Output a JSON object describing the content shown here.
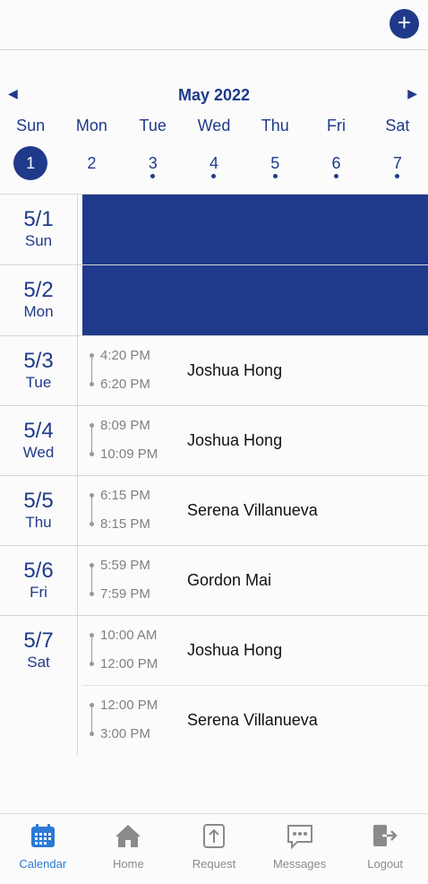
{
  "header": {
    "add_icon": "plus-icon"
  },
  "calendar": {
    "month": "May 2022",
    "weekdays": [
      "Sun",
      "Mon",
      "Tue",
      "Wed",
      "Thu",
      "Fri",
      "Sat"
    ],
    "dates": [
      {
        "num": "1",
        "selected": true,
        "dot": false
      },
      {
        "num": "2",
        "selected": false,
        "dot": false
      },
      {
        "num": "3",
        "selected": false,
        "dot": true
      },
      {
        "num": "4",
        "selected": false,
        "dot": true
      },
      {
        "num": "5",
        "selected": false,
        "dot": true
      },
      {
        "num": "6",
        "selected": false,
        "dot": true
      },
      {
        "num": "7",
        "selected": false,
        "dot": true
      }
    ]
  },
  "days": [
    {
      "date": "5/1",
      "weekday": "Sun",
      "shifts": []
    },
    {
      "date": "5/2",
      "weekday": "Mon",
      "shifts": []
    },
    {
      "date": "5/3",
      "weekday": "Tue",
      "shifts": [
        {
          "start": "4:20 PM",
          "end": "6:20 PM",
          "name": "Joshua Hong"
        }
      ]
    },
    {
      "date": "5/4",
      "weekday": "Wed",
      "shifts": [
        {
          "start": "8:09 PM",
          "end": "10:09 PM",
          "name": "Joshua Hong"
        }
      ]
    },
    {
      "date": "5/5",
      "weekday": "Thu",
      "shifts": [
        {
          "start": "6:15 PM",
          "end": "8:15 PM",
          "name": "Serena Villanueva"
        }
      ]
    },
    {
      "date": "5/6",
      "weekday": "Fri",
      "shifts": [
        {
          "start": "5:59 PM",
          "end": "7:59 PM",
          "name": "Gordon Mai"
        }
      ]
    },
    {
      "date": "5/7",
      "weekday": "Sat",
      "shifts": [
        {
          "start": "10:00 AM",
          "end": "12:00 PM",
          "name": "Joshua Hong"
        },
        {
          "start": "12:00 PM",
          "end": "3:00 PM",
          "name": "Serena Villanueva"
        }
      ]
    }
  ],
  "tabs": [
    {
      "label": "Calendar",
      "icon": "calendar-icon",
      "active": true
    },
    {
      "label": "Home",
      "icon": "home-icon",
      "active": false
    },
    {
      "label": "Request",
      "icon": "upload-icon",
      "active": false
    },
    {
      "label": "Messages",
      "icon": "chat-icon",
      "active": false
    },
    {
      "label": "Logout",
      "icon": "logout-icon",
      "active": false
    }
  ],
  "colors": {
    "primary": "#1f3a8a",
    "active_tab": "#2a7ad6",
    "muted": "#8a8a8a"
  }
}
